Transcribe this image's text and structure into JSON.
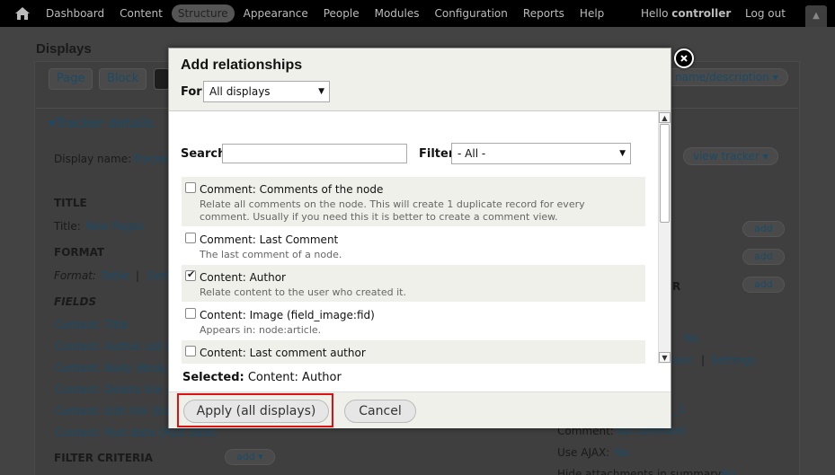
{
  "toolbar": {
    "menu": [
      "Dashboard",
      "Content",
      "Structure",
      "Appearance",
      "People",
      "Modules",
      "Configuration",
      "Reports",
      "Help"
    ],
    "active_index": 2,
    "hello": "Hello",
    "user": "controller",
    "logout": "Log out"
  },
  "page": {
    "title": "Displays",
    "tabs": [
      "Page",
      "Block"
    ],
    "name_description": "name/description",
    "section": "Tracker details",
    "display_name_label": "Display name:",
    "display_name_value": "Tracke",
    "view_tracker": "view tracker",
    "title_head": "TITLE",
    "title_label": "Title:",
    "title_value": "New Pages",
    "format_head": "FORMAT",
    "format_label": "Format:",
    "format_value": "Table",
    "format_sep": "|",
    "format_settings": "Sett",
    "fields_head": "FIELDS",
    "fields": [
      "Content: Title",
      "Content: Author uid (A",
      "Content: Body (Body)",
      "Content: Delete link (D",
      "Content: Edit link (Edi",
      "Content: Post date (Post date)"
    ],
    "filter_head": "FILTER CRITERIA",
    "add": "add",
    "right_r": "R",
    "right_no": "No",
    "right_basic": "asic",
    "right_sep": "|",
    "right_settings": "Settings",
    "right_l": "_1",
    "comment_label": "Comment:",
    "comment_value": "No comment",
    "ajax_label": "Use AJAX:",
    "ajax_value": "No",
    "hide_label": "Hide attachments in summary:",
    "hide_value": "No"
  },
  "modal": {
    "title": "Add relationships",
    "for_label": "For",
    "for_value": "All displays",
    "search_label": "Search",
    "search_value": "",
    "filter_label": "Filter",
    "filter_value": "- All -",
    "options": [
      {
        "title": "Comment: Comments of the node",
        "desc": "Relate all comments on the node. This will create 1 duplicate record for every comment. Usually if you need this it is better to create a comment view.",
        "checked": false
      },
      {
        "title": "Comment: Last Comment",
        "desc": "The last comment of a node.",
        "checked": false
      },
      {
        "title": "Content: Author",
        "desc": "Relate content to the user who created it.",
        "checked": true
      },
      {
        "title": "Content: Image (field_image:fid)",
        "desc": "Appears in: node:article.",
        "checked": false
      },
      {
        "title": "Content: Last comment author",
        "desc": "",
        "checked": false
      }
    ],
    "selected_label": "Selected:",
    "selected_value": "Content: Author",
    "apply_label": "Apply (all displays)",
    "cancel_label": "Cancel"
  }
}
